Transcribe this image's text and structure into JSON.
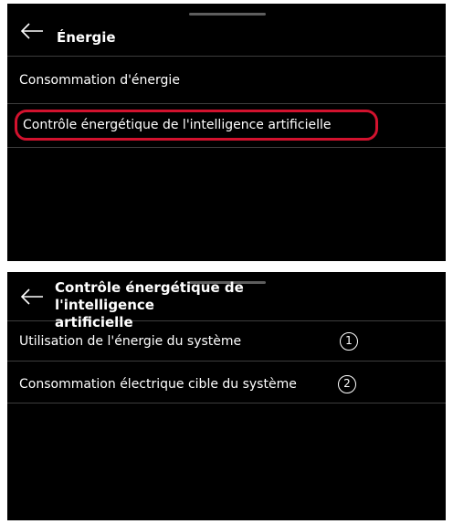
{
  "screen1": {
    "title": "Énergie",
    "items": [
      {
        "label": "Consommation d'énergie"
      },
      {
        "label": "Contrôle énergétique de l'intelligence artificielle"
      }
    ],
    "highlight_color": "#d2122e"
  },
  "screen2": {
    "title_line1": "Contrôle énergétique de l'intelligence",
    "title_line2": "artificielle",
    "items": [
      {
        "label": "Utilisation de l'énergie du système",
        "marker": "1"
      },
      {
        "label": "Consommation électrique cible du système",
        "marker": "2"
      }
    ]
  },
  "icons": {
    "back": "arrow-left-icon",
    "handle": "drag-handle"
  },
  "colors": {
    "background": "#000000",
    "text": "#ffffff",
    "divider": "#3d3d3d"
  }
}
